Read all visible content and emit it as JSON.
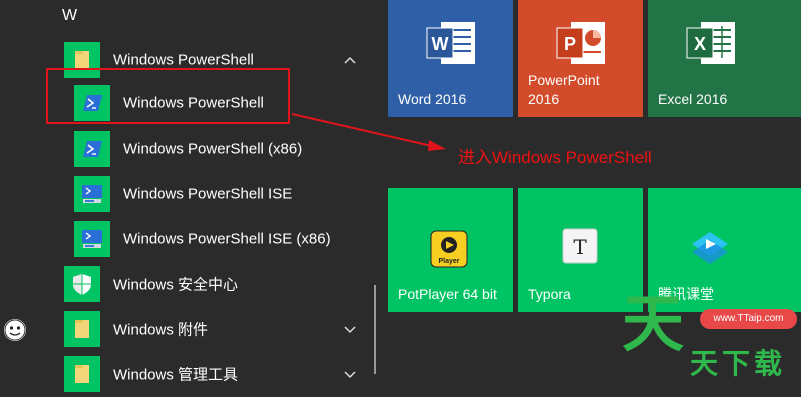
{
  "applist": {
    "section_letter": "W",
    "items": [
      {
        "label": "Windows PowerShell"
      },
      {
        "label": "Windows PowerShell"
      },
      {
        "label": "Windows PowerShell (x86)"
      },
      {
        "label": "Windows PowerShell ISE"
      },
      {
        "label": "Windows PowerShell ISE (x86)"
      },
      {
        "label": "Windows 安全中心"
      },
      {
        "label": "Windows 附件"
      },
      {
        "label": "Windows 管理工具"
      }
    ]
  },
  "tiles": {
    "word": {
      "label": "Word 2016",
      "glyph": "W"
    },
    "powerpoint": {
      "label_line1": "PowerPoint",
      "label_line2": "2016",
      "glyph": "P"
    },
    "excel": {
      "label": "Excel 2016",
      "glyph": "X"
    },
    "potplayer": {
      "label": "PotPlayer 64 bit",
      "glyph": "Player"
    },
    "typora": {
      "label": "Typora",
      "glyph": "T"
    },
    "tencent": {
      "label": "腾讯课堂"
    }
  },
  "annotation": {
    "text": "进入Windows PowerShell"
  },
  "watermark": {
    "badge": "www.TTaip.com",
    "big": "天",
    "bottom": "天下载"
  },
  "colors": {
    "accent": "#00c464",
    "word": "#2f5fa6",
    "powerpoint": "#d24b2a",
    "excel": "#227447",
    "annotation": "#ee1111"
  }
}
